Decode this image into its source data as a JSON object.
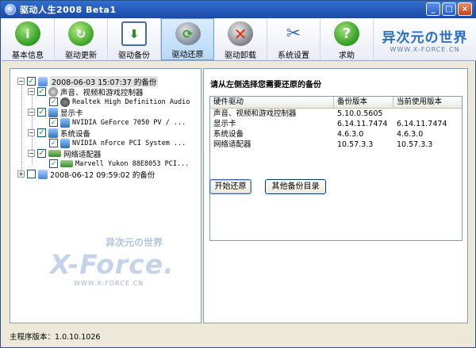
{
  "window": {
    "title": "驱动人生2008 Beta1",
    "minimize": "_",
    "maximize": "□",
    "close": "×"
  },
  "toolbar": {
    "items": [
      {
        "label": "基本信息",
        "glyph": "i"
      },
      {
        "label": "驱动更新",
        "glyph": "↻"
      },
      {
        "label": "驱动备份",
        "glyph": "⬇"
      },
      {
        "label": "驱动还原",
        "glyph": "⟳"
      },
      {
        "label": "驱动卸载",
        "glyph": "✕"
      },
      {
        "label": "系统设置",
        "glyph": "✂"
      },
      {
        "label": "求助",
        "glyph": "?"
      }
    ],
    "active_index": 3,
    "logo": {
      "main": "异次元の世界",
      "sub": "WWW.X-FORCE.CN"
    }
  },
  "tree": {
    "backup1_label": "2008-06-03 15:07:37 的备份",
    "audio_group": "声音、视频和游戏控制器",
    "audio_item": "Realtek High Definition Audio",
    "display_group": "显示卡",
    "display_item": "NVIDIA GeForce 7050 PV / ...",
    "system_group": "系统设备",
    "system_item": "NVIDIA nForce PCI System ...",
    "net_group": "网络适配器",
    "net_item": "Marvell Yukon 88E8053 PCI...",
    "backup2_label": "2008-06-12 09:59:02 的备份",
    "watermark": {
      "cn": "异次元の世界",
      "big": "X-Force.",
      "url": "WWW.X-FORCE.CN"
    }
  },
  "main": {
    "prompt": "请从左侧选择您需要还原的备份",
    "headers": [
      "硬件驱动",
      "备份版本",
      "当前使用版本"
    ],
    "rows": [
      [
        "声音、视频和游戏控制器",
        "5.10.0.5605",
        ""
      ],
      [
        "显示卡",
        "6.14.11.7474",
        "6.14.11.7474"
      ],
      [
        "系统设备",
        "4.6.3.0",
        "4.6.3.0"
      ],
      [
        "网络适配器",
        "10.57.3.3",
        "10.57.3.3"
      ]
    ],
    "restore_button": "开始还原",
    "other_dir_button": "其他备份目录"
  },
  "status": {
    "text": "主程序版本：1.0.10.1026"
  }
}
